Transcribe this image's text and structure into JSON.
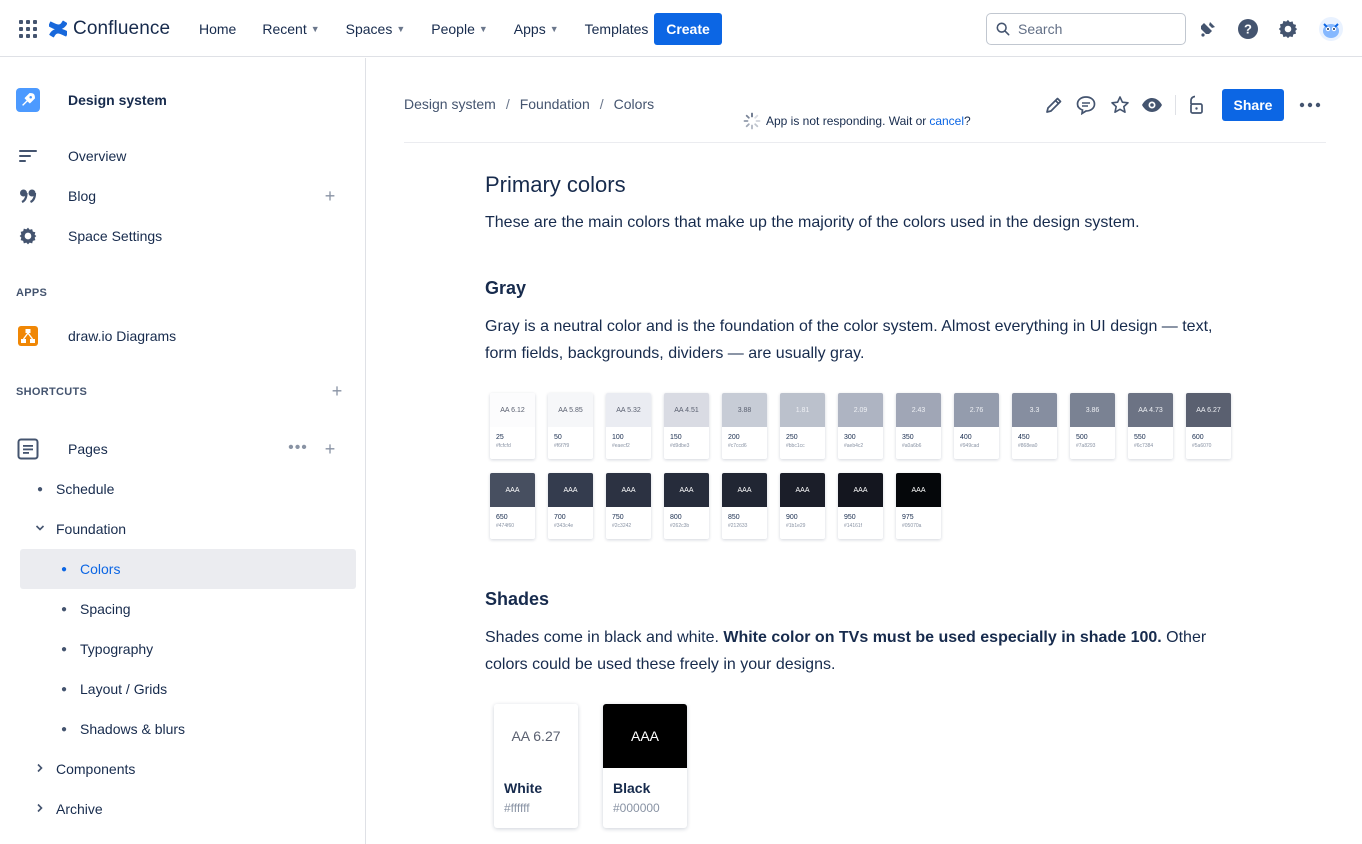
{
  "topbar": {
    "app_name": "Confluence",
    "nav": [
      {
        "label": "Home",
        "dropdown": false
      },
      {
        "label": "Recent",
        "dropdown": true
      },
      {
        "label": "Spaces",
        "dropdown": true
      },
      {
        "label": "People",
        "dropdown": true
      },
      {
        "label": "Apps",
        "dropdown": true
      },
      {
        "label": "Templates",
        "dropdown": false
      }
    ],
    "create_label": "Create",
    "search_placeholder": "Search",
    "icons": [
      "notifications-icon",
      "help-icon",
      "settings-icon",
      "avatar"
    ]
  },
  "sidebar": {
    "space_name": "Design system",
    "items": [
      {
        "label": "Overview",
        "icon": "overview-icon"
      },
      {
        "label": "Blog",
        "icon": "quote-icon"
      },
      {
        "label": "Space Settings",
        "icon": "gear-icon"
      }
    ],
    "apps_heading": "APPS",
    "apps": [
      {
        "label": "draw.io Diagrams",
        "icon": "drawio-icon"
      }
    ],
    "shortcuts_heading": "SHORTCUTS",
    "pages_label": "Pages",
    "tree": [
      {
        "label": "Schedule",
        "level": 1,
        "type": "bullet"
      },
      {
        "label": "Foundation",
        "level": 1,
        "type": "expanded"
      },
      {
        "label": "Colors",
        "level": 2,
        "type": "bullet",
        "selected": true
      },
      {
        "label": "Spacing",
        "level": 2,
        "type": "bullet"
      },
      {
        "label": "Typography",
        "level": 2,
        "type": "bullet"
      },
      {
        "label": "Layout / Grids",
        "level": 2,
        "type": "bullet"
      },
      {
        "label": "Shadows & blurs",
        "level": 2,
        "type": "bullet"
      },
      {
        "label": "Components",
        "level": 1,
        "type": "collapsed"
      },
      {
        "label": "Archive",
        "level": 1,
        "type": "collapsed"
      }
    ]
  },
  "page": {
    "breadcrumb": [
      "Design system",
      "Foundation",
      "Colors"
    ],
    "share_label": "Share",
    "notice_text": "App is not responding. Wait or ",
    "notice_link": "cancel",
    "notice_end": "?",
    "title": "Primary colors",
    "intro": "These are the main colors that make up the majority of the colors used in the design system.",
    "gray_heading": "Gray",
    "gray_text": "Gray is a neutral color and is the foundation of the color system. Almost everything in UI design — text, form fields, backgrounds, dividers — are usually gray.",
    "gray_swatches": [
      {
        "label": "AA 6.12",
        "num": "25",
        "hex": "#fcfcfd",
        "bg": "#fcfcfd",
        "fg": "#5a6070"
      },
      {
        "label": "AA 5.85",
        "num": "50",
        "hex": "#f6f7f9",
        "bg": "#f6f7f9",
        "fg": "#5a6070"
      },
      {
        "label": "AA 5.32",
        "num": "100",
        "hex": "#eaecf2",
        "bg": "#eaecf2",
        "fg": "#5a6070"
      },
      {
        "label": "AA 4.51",
        "num": "150",
        "hex": "#d9dbe3",
        "bg": "#d9dbe3",
        "fg": "#5a6070"
      },
      {
        "label": "3.88",
        "num": "200",
        "hex": "#c7ccd6",
        "bg": "#c7ccd6",
        "fg": "#5a6070"
      },
      {
        "label": "1.81",
        "num": "250",
        "hex": "#bbc1cc",
        "bg": "#bbc1cc",
        "fg": "#eef0f4"
      },
      {
        "label": "2.09",
        "num": "300",
        "hex": "#aeb4c2",
        "bg": "#aeb4c2",
        "fg": "#eef0f4"
      },
      {
        "label": "2.43",
        "num": "350",
        "hex": "#a0a6b6",
        "bg": "#a0a6b6",
        "fg": "#eef0f4"
      },
      {
        "label": "2.76",
        "num": "400",
        "hex": "#949cad",
        "bg": "#949cad",
        "fg": "#eef0f4"
      },
      {
        "label": "3.3",
        "num": "450",
        "hex": "#868ea0",
        "bg": "#868ea0",
        "fg": "#eef0f4"
      },
      {
        "label": "3.86",
        "num": "500",
        "hex": "#7a8293",
        "bg": "#7a8293",
        "fg": "#eef0f4"
      },
      {
        "label": "AA 4.73",
        "num": "550",
        "hex": "#6c7384",
        "bg": "#6c7384",
        "fg": "#eef0f4"
      },
      {
        "label": "AA 6.27",
        "num": "600",
        "hex": "#5a6070",
        "bg": "#5a6070",
        "fg": "#eef0f4"
      },
      {
        "label": "AAA",
        "num": "650",
        "hex": "#474f60",
        "bg": "#474f60",
        "fg": "#ffffff"
      },
      {
        "label": "AAA",
        "num": "700",
        "hex": "#343c4e",
        "bg": "#343c4e",
        "fg": "#ffffff"
      },
      {
        "label": "AAA",
        "num": "750",
        "hex": "#2c3242",
        "bg": "#2c3242",
        "fg": "#ffffff"
      },
      {
        "label": "AAA",
        "num": "800",
        "hex": "#262c3b",
        "bg": "#262c3b",
        "fg": "#ffffff"
      },
      {
        "label": "AAA",
        "num": "850",
        "hex": "#212633",
        "bg": "#212633",
        "fg": "#ffffff"
      },
      {
        "label": "AAA",
        "num": "900",
        "hex": "#1b1e29",
        "bg": "#1b1e29",
        "fg": "#ffffff"
      },
      {
        "label": "AAA",
        "num": "950",
        "hex": "#14161f",
        "bg": "#14161f",
        "fg": "#ffffff"
      },
      {
        "label": "AAA",
        "num": "975",
        "hex": "#05070a",
        "bg": "#05070a",
        "fg": "#ffffff"
      }
    ],
    "shades_heading": "Shades",
    "shades_text_1": "Shades come in black and white. ",
    "shades_text_bold": "White color on TVs must be used especially in shade 100.",
    "shades_text_2": " Other colors could be used these freely in your designs.",
    "shade_swatches": [
      {
        "label": "AA 6.27",
        "name": "White",
        "hex": "#ffffff",
        "bg": "#ffffff",
        "fg": "#5a6070"
      },
      {
        "label": "AAA",
        "name": "Black",
        "hex": "#000000",
        "bg": "#000000",
        "fg": "#ffffff"
      }
    ]
  }
}
